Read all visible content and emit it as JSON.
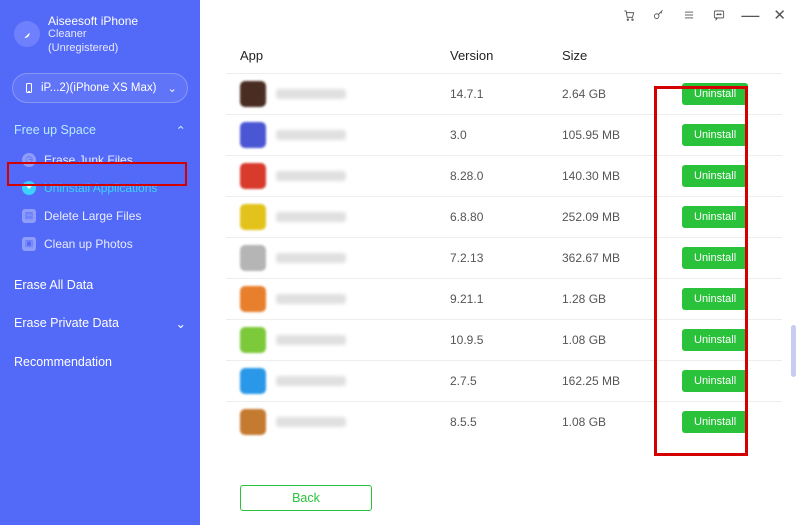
{
  "brand": {
    "line1": "Aiseesoft iPhone",
    "line2": "Cleaner",
    "status": "(Unregistered)"
  },
  "device": {
    "label": "iP...2)(iPhone XS Max)"
  },
  "sidebar": {
    "sections": {
      "freeup": {
        "title": "Free up Space",
        "items": [
          {
            "label": "Erase Junk Files"
          },
          {
            "label": "Uninstall Applications"
          },
          {
            "label": "Delete Large Files"
          },
          {
            "label": "Clean up Photos"
          }
        ]
      }
    },
    "eraseAll": "Erase All Data",
    "erasePrivate": "Erase Private Data",
    "recommendation": "Recommendation"
  },
  "columns": {
    "app": "App",
    "version": "Version",
    "size": "Size"
  },
  "buttons": {
    "uninstall": "Uninstall",
    "back": "Back"
  },
  "apps": [
    {
      "version": "14.7.1",
      "size": "2.64 GB",
      "color": "#4a2d22"
    },
    {
      "version": "3.0",
      "size": "105.95 MB",
      "color": "#4a56d4"
    },
    {
      "version": "8.28.0",
      "size": "140.30 MB",
      "color": "#d83a2c"
    },
    {
      "version": "6.8.80",
      "size": "252.09 MB",
      "color": "#e3c31b"
    },
    {
      "version": "7.2.13",
      "size": "362.67 MB",
      "color": "#b5b5b5"
    },
    {
      "version": "9.21.1",
      "size": "1.28 GB",
      "color": "#e77f2c"
    },
    {
      "version": "10.9.5",
      "size": "1.08 GB",
      "color": "#7cc93a"
    },
    {
      "version": "2.7.5",
      "size": "162.25 MB",
      "color": "#2a98e8"
    },
    {
      "version": "8.5.5",
      "size": "1.08 GB",
      "color": "#c47a2f"
    }
  ]
}
